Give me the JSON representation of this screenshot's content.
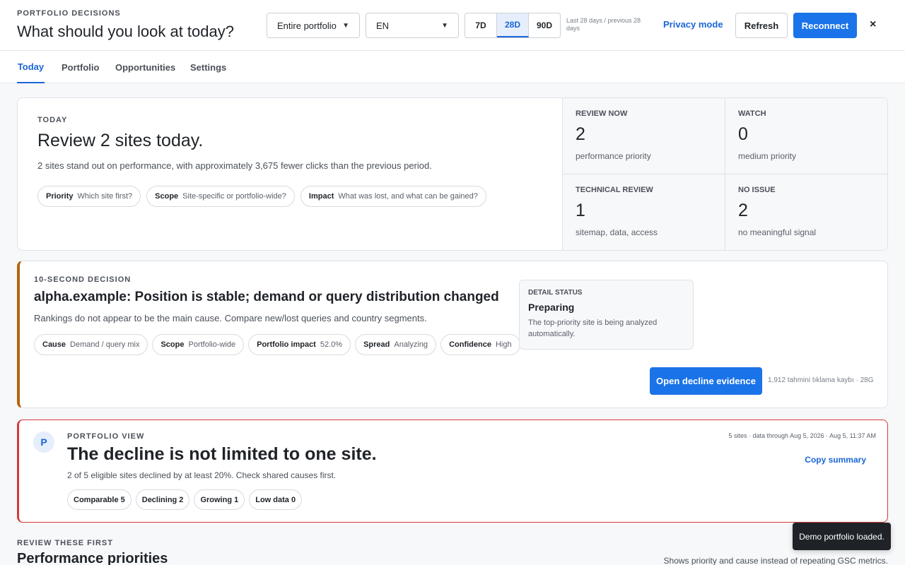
{
  "header": {
    "eyebrow": "PORTFOLIO DECISIONS",
    "title": "What should you look at today?",
    "scope_select": "Entire portfolio",
    "lang_select": "EN",
    "periods": [
      "7D",
      "28D",
      "90D"
    ],
    "active_period": "28D",
    "period_note": "Last 28 days / previous 28 days",
    "privacy_label": "Privacy mode",
    "refresh_label": "Refresh",
    "reconnect_label": "Reconnect",
    "close_glyph": "×"
  },
  "tabs": [
    "Today",
    "Portfolio",
    "Opportunities",
    "Settings"
  ],
  "today": {
    "eyebrow": "TODAY",
    "heading": "Review 2 sites today.",
    "subtitle": "2 sites stand out on performance, with approximately 3,675 fewer clicks than the previous period.",
    "chips": [
      {
        "key": "Priority",
        "value": "Which site first?"
      },
      {
        "key": "Scope",
        "value": "Site-specific or portfolio-wide?"
      },
      {
        "key": "Impact",
        "value": "What was lost, and what can be gained?"
      }
    ],
    "stats": [
      {
        "label": "REVIEW NOW",
        "value": "2",
        "desc": "performance priority"
      },
      {
        "label": "WATCH",
        "value": "0",
        "desc": "medium priority"
      },
      {
        "label": "TECHNICAL REVIEW",
        "value": "1",
        "desc": "sitemap, data, access"
      },
      {
        "label": "NO ISSUE",
        "value": "2",
        "desc": "no meaningful signal"
      }
    ]
  },
  "decision": {
    "eyebrow": "10-SECOND DECISION",
    "heading": "alpha.example: Position is stable; demand or query distribution changed",
    "subtitle": "Rankings do not appear to be the main cause. Compare new/lost queries and country segments.",
    "chips": [
      {
        "key": "Cause",
        "value": "Demand / query mix"
      },
      {
        "key": "Scope",
        "value": "Portfolio-wide"
      },
      {
        "key": "Portfolio impact",
        "value": "52.0%"
      },
      {
        "key": "Spread",
        "value": "Analyzing"
      },
      {
        "key": "Confidence",
        "value": "High"
      }
    ],
    "detail": {
      "label": "DETAIL STATUS",
      "status": "Preparing",
      "desc": "The top-priority site is being analyzed automatically."
    },
    "evidence_button": "Open decline evidence",
    "evidence_note": "1,912 tahmini tıklama kaybı · 28G",
    "accent_color": "#b3650f"
  },
  "portfolio": {
    "avatar": "P",
    "eyebrow": "PORTFOLIO VIEW",
    "heading": "The decline is not limited to one site.",
    "subtitle": "2 of 5 eligible sites declined by at least 20%. Check shared causes first.",
    "meta": "5 sites · data through Aug 5, 2026 · Aug 5, 11:37 AM",
    "copy_label": "Copy summary",
    "chips": [
      "Comparable 5",
      "Declining 2",
      "Growing 1",
      "Low data 0"
    ],
    "accent_color": "#d33a3a"
  },
  "review": {
    "eyebrow": "REVIEW THESE FIRST",
    "heading": "Performance priorities",
    "note": "Shows priority and cause instead of repeating GSC metrics."
  },
  "toast": "Demo portfolio loaded.",
  "colors": {
    "primary": "#1a73e8",
    "link": "#1a66d9"
  }
}
